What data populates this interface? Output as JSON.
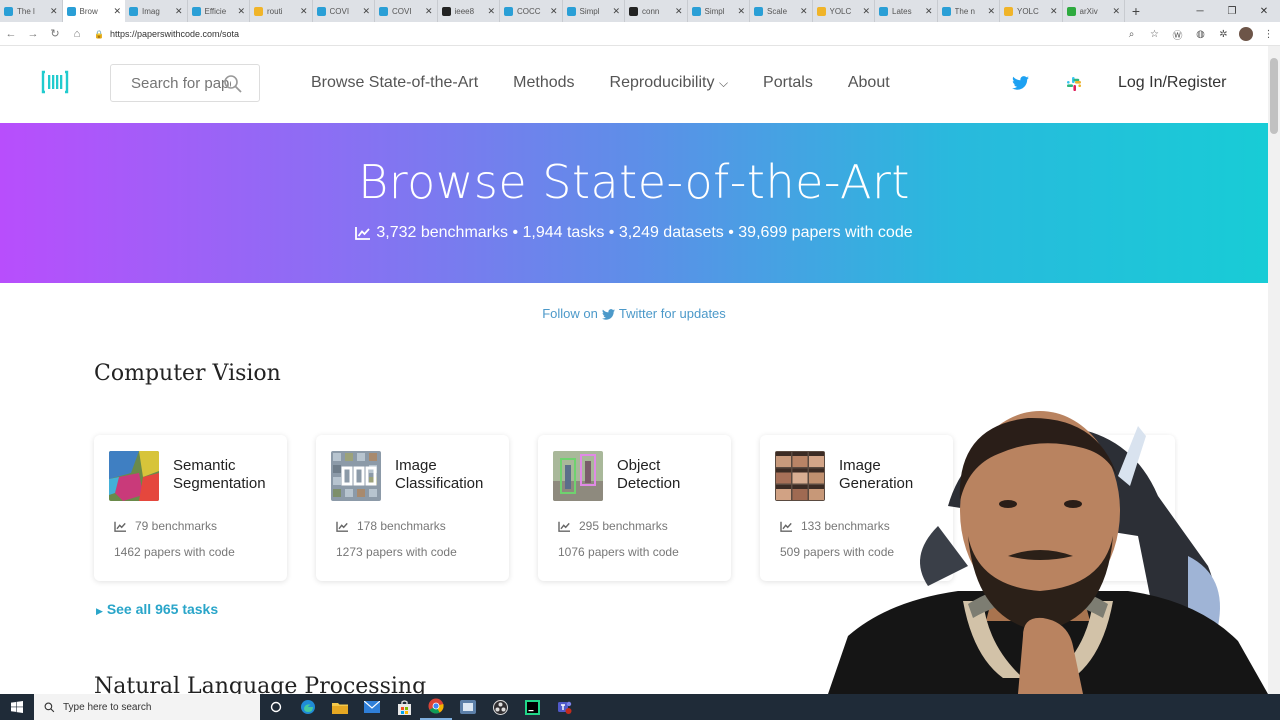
{
  "browser": {
    "tabs": [
      {
        "title": "The l",
        "favicon": "pwc-icon",
        "color": "#2a9fd6"
      },
      {
        "title": "Brow",
        "favicon": "pwc-icon",
        "color": "#2a9fd6",
        "active": true
      },
      {
        "title": "Imag",
        "favicon": "pwc-icon",
        "color": "#2a9fd6"
      },
      {
        "title": "Efficie",
        "favicon": "pwc-icon",
        "color": "#2a9fd6"
      },
      {
        "title": "routi",
        "favicon": "chain-icon",
        "color": "#f0b429"
      },
      {
        "title": "COVI",
        "favicon": "pwc-icon",
        "color": "#2a9fd6"
      },
      {
        "title": "COVI",
        "favicon": "pwc-icon",
        "color": "#2a9fd6"
      },
      {
        "title": "ieee8",
        "favicon": "github-icon",
        "color": "#222222"
      },
      {
        "title": "COCC",
        "favicon": "pwc-icon",
        "color": "#2a9fd6"
      },
      {
        "title": "Simpl",
        "favicon": "pwc-icon",
        "color": "#2a9fd6"
      },
      {
        "title": "conn",
        "favicon": "github-icon",
        "color": "#222222"
      },
      {
        "title": "Simpl",
        "favicon": "pwc-icon",
        "color": "#2a9fd6"
      },
      {
        "title": "Scale",
        "favicon": "pwc-icon",
        "color": "#2a9fd6"
      },
      {
        "title": "YOLC",
        "favicon": "chain-icon",
        "color": "#f0b429"
      },
      {
        "title": "Lates",
        "favicon": "pwc-icon",
        "color": "#2a9fd6"
      },
      {
        "title": "The n",
        "favicon": "pwc-icon",
        "color": "#2a9fd6"
      },
      {
        "title": "YOLC",
        "favicon": "chain-icon",
        "color": "#f0b429"
      },
      {
        "title": "arXiv",
        "favicon": "arxiv-icon",
        "color": "#2eaa3f"
      }
    ],
    "new_tab": "+",
    "window_buttons": {
      "minimize": "─",
      "restore": "❐",
      "close": "✕"
    },
    "url": "https://paperswithcode.com/sota",
    "nav": {
      "back": "←",
      "forward": "→",
      "reload": "↻",
      "home": "⌂"
    }
  },
  "navbar": {
    "search_placeholder": "Search for papers",
    "links": [
      "Browse State-of-the-Art",
      "Methods",
      "Reproducibility",
      "Portals",
      "About"
    ],
    "reproducibility_caret": "⌵",
    "login": "Log In/Register",
    "colors": {
      "twitter": "#1da1f2",
      "brand": "#21cbce"
    }
  },
  "hero": {
    "title": "Browse State-of-the-Art",
    "stats": "3,732 benchmarks • 1,944 tasks • 3,249 datasets • 39,699 papers with code"
  },
  "follow": {
    "prefix": "Follow on",
    "link": "Twitter for updates"
  },
  "computer_vision": {
    "title": "Computer Vision",
    "cards": [
      {
        "name": "Semantic Segmentation",
        "benchmarks": "79 benchmarks",
        "papers": "1462 papers with code",
        "thumb": "segmentation-thumb"
      },
      {
        "name": "Image Classification",
        "benchmarks": "178 benchmarks",
        "papers": "1273 papers with code",
        "thumb": "classification-thumb"
      },
      {
        "name": "Object Detection",
        "benchmarks": "295 benchmarks",
        "papers": "1076 papers with code",
        "thumb": "detection-thumb"
      },
      {
        "name": "Image Generation",
        "benchmarks": "133 benchmarks",
        "papers": "509 papers with code",
        "thumb": "generation-thumb"
      }
    ],
    "see_all": "See all 965 tasks"
  },
  "nlp": {
    "title": "Natural Language Processing"
  },
  "taskbar": {
    "search_placeholder": "Type here to search"
  }
}
